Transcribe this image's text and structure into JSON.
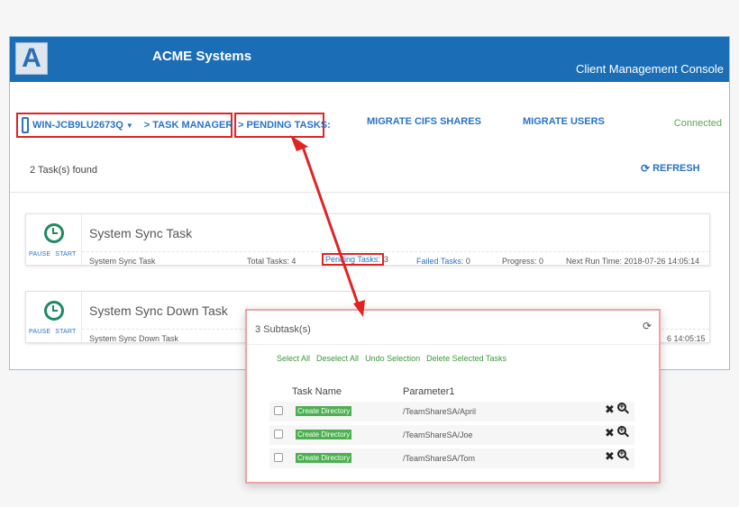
{
  "header": {
    "logo_letter": "A",
    "app_name": "ACME Systems",
    "console_title": "Client Management Console"
  },
  "nav": {
    "server_name": "WIN-JCB9LU2673Q",
    "task_manager": "> TASK MANAGER",
    "pending_tasks": "> PENDING TASKS:",
    "links": [
      "MIGRATE CIFS SHARES",
      "MIGRATE USERS"
    ],
    "status": "Connected"
  },
  "toolbar": {
    "found_text": "2 Task(s) found",
    "refresh_label": "REFRESH"
  },
  "tasks": [
    {
      "name": "System Sync Task",
      "pause_label": "PAUSE",
      "start_label": "START",
      "subname": "System Sync Task",
      "total": "Total Tasks: 4",
      "pending_label": "Pending Tasks:",
      "pending_value": "3",
      "failed_label": "Failed Tasks:",
      "failed_value": "0",
      "progress": "Progress: 0",
      "next_run": "Next Run Time: 2018-07-26 14:05:14"
    },
    {
      "name": "System Sync Down Task",
      "pause_label": "PAUSE",
      "start_label": "START",
      "subname": "System Sync Down Task",
      "next_run_partial": "6 14:05:15"
    }
  ],
  "subtasks_popup": {
    "title": "3 Subtask(s)",
    "actions": [
      "Select All",
      "Deselect All",
      "Undo Selection",
      "Delete Selected Tasks"
    ],
    "columns": [
      "Task Name",
      "Parameter1"
    ],
    "rows": [
      {
        "task": "Create Directory",
        "param": "/TeamShareSA/April"
      },
      {
        "task": "Create Directory",
        "param": "/TeamShareSA/Joe"
      },
      {
        "task": "Create Directory",
        "param": "/TeamShareSA/Tom"
      }
    ]
  },
  "icons": {
    "delete": "close-icon",
    "view": "zoom-in-icon",
    "refresh": "refresh-icon",
    "task": "clock-icon"
  },
  "colors": {
    "banner": "#1b6db5",
    "link": "#2a73c6",
    "highlight": "#e02424",
    "connected": "#5ba84c",
    "badge": "#4caf50",
    "clock": "#1f8a62"
  }
}
